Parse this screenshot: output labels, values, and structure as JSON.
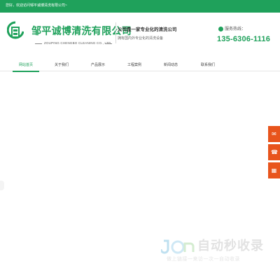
{
  "topbar": {
    "greeting": "您好，欢迎访问邹平诚博清洗有限公司~"
  },
  "brand": {
    "name_cn": "邹平诚博清洗有限公司",
    "name_en": "ZOUPING CHENGBO CLEANING CO., LTD.",
    "slogan_main": "公司是一家专业化的清洗公司",
    "slogan_sub": "拥有国内外专业化的清洗设备",
    "hotline_label": "服务热线：",
    "hotline_number": "135-6306-1116",
    "color_primary": "#1fa15b"
  },
  "nav": {
    "items": [
      {
        "label": "网站首页",
        "active": true
      },
      {
        "label": "关于我们",
        "active": false
      },
      {
        "label": "产品展示",
        "active": false
      },
      {
        "label": "工程案例",
        "active": false
      },
      {
        "label": "新闻动态",
        "active": false
      },
      {
        "label": "联系我们",
        "active": false
      }
    ]
  },
  "side_toolbar": {
    "color": "#e8541c",
    "icons": [
      "message-icon",
      "phone-icon",
      "qrcode-icon"
    ]
  },
  "watermark": {
    "title": "自动秒收录",
    "sub": "做上链接一来访一次一自动收录"
  }
}
